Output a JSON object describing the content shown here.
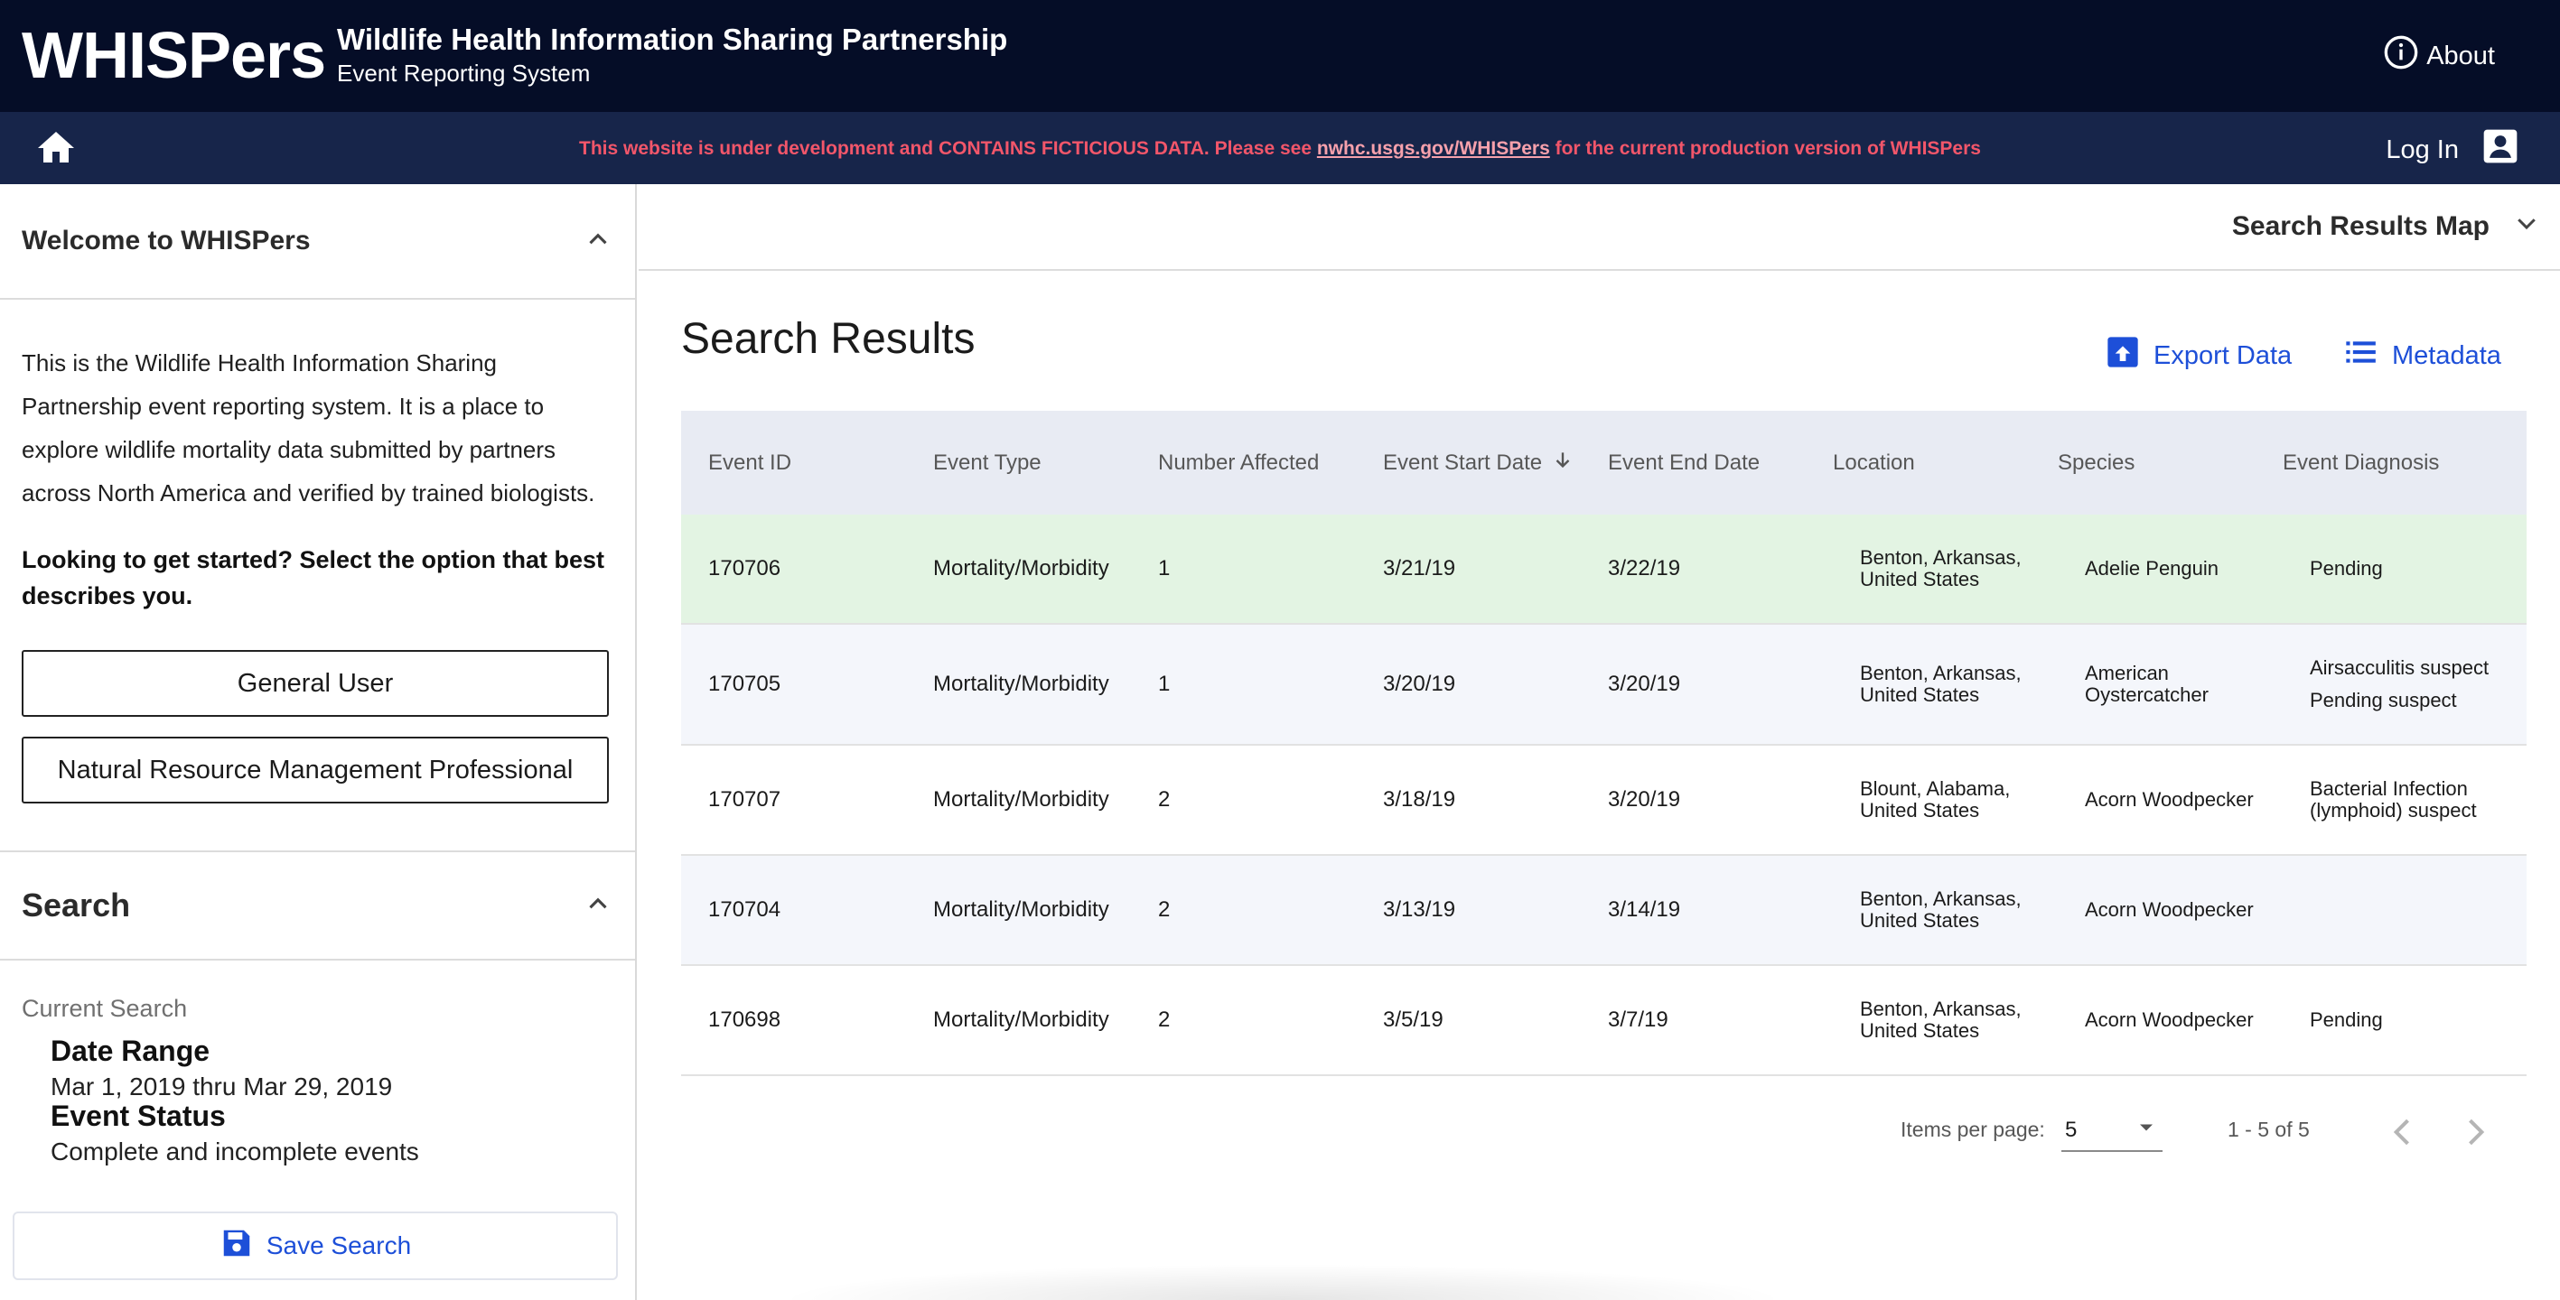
{
  "header": {
    "logo": "WHISPers",
    "title": "Wildlife Health Information Sharing Partnership",
    "subtitle": "Event Reporting System",
    "about_label": "About",
    "bg_color": "#050d27"
  },
  "subbar": {
    "notice_prefix": "This website is under development and CONTAINS FICTICIOUS DATA. Please see ",
    "notice_link": "nwhc.usgs.gov/WHISPers",
    "notice_suffix": " for the current production version of WHISPers",
    "login_label": "Log In",
    "notice_color": "#f2566a"
  },
  "sidebar": {
    "welcome_title": "Welcome to WHISPers",
    "welcome_text": "This is the Wildlife Health Information Sharing Partnership event reporting system. It is a place to explore wildlife mortality data submitted by partners across North America and verified by trained biologists.",
    "get_started": "Looking to get started? Select the option that best describes you.",
    "buttons": [
      "General User",
      "Natural Resource Management Professional"
    ],
    "search_title": "Search",
    "current_search_label": "Current Search",
    "criteria": [
      {
        "label": "Date Range",
        "value": "Mar 1, 2019 thru Mar 29, 2019"
      },
      {
        "label": "Event Status",
        "value": "Complete and incomplete events"
      }
    ],
    "save_search_label": "Save Search"
  },
  "main": {
    "map_toggle_label": "Search Results Map",
    "results_title": "Search Results",
    "export_label": "Export Data",
    "metadata_label": "Metadata",
    "accent_color": "#1d4fd8",
    "highlight_row_color": "#e3f4e3"
  },
  "table": {
    "columns": [
      "Event ID",
      "Event Type",
      "Number Affected",
      "Event Start Date",
      "Event End Date",
      "Location",
      "Species",
      "Event Diagnosis"
    ],
    "rows": [
      {
        "id": "170706",
        "type": "Mortality/Morbidity",
        "affected": "1",
        "start": "3/21/19",
        "end": "3/22/19",
        "location": "Benton, Arkansas, United States",
        "species": "Adelie Penguin",
        "diagnosis": [
          "Pending"
        ]
      },
      {
        "id": "170705",
        "type": "Mortality/Morbidity",
        "affected": "1",
        "start": "3/20/19",
        "end": "3/20/19",
        "location": "Benton, Arkansas, United States",
        "species": "American Oystercatcher",
        "diagnosis": [
          "Airsacculitis suspect",
          "Pending suspect"
        ]
      },
      {
        "id": "170707",
        "type": "Mortality/Morbidity",
        "affected": "2",
        "start": "3/18/19",
        "end": "3/20/19",
        "location": "Blount, Alabama, United States",
        "species": "Acorn Woodpecker",
        "diagnosis": [
          "Bacterial Infection (lymphoid) suspect"
        ]
      },
      {
        "id": "170704",
        "type": "Mortality/Morbidity",
        "affected": "2",
        "start": "3/13/19",
        "end": "3/14/19",
        "location": "Benton, Arkansas, United States",
        "species": "Acorn Woodpecker",
        "diagnosis": []
      },
      {
        "id": "170698",
        "type": "Mortality/Morbidity",
        "affected": "2",
        "start": "3/5/19",
        "end": "3/7/19",
        "location": "Benton, Arkansas, United States",
        "species": "Acorn Woodpecker",
        "diagnosis": [
          "Pending"
        ]
      }
    ]
  },
  "paginator": {
    "items_per_page_label": "Items per page:",
    "items_per_page_value": "5",
    "range_label": "1 - 5 of 5"
  },
  "icons": {
    "about": "info-circle-icon",
    "home": "home-icon",
    "login": "account-box-icon",
    "collapse": "chevron-up-icon",
    "map": "chevron-down-icon",
    "export": "upload-box-icon",
    "metadata": "list-icon",
    "save": "floppy-disk-icon",
    "sort": "arrow-down-icon",
    "prev": "chevron-left-icon",
    "next": "chevron-right-icon"
  }
}
